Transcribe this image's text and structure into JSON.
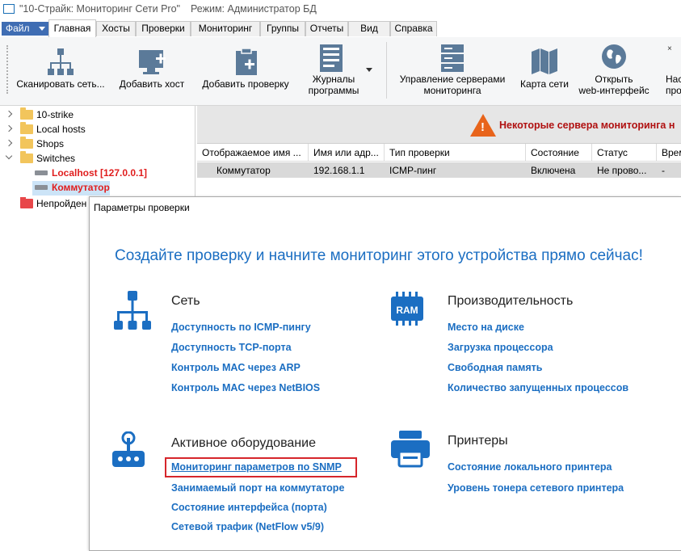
{
  "window": {
    "title": "\"10-Страйк: Мониторинг Сети Pro\"",
    "mode": "Режим: Администратор БД"
  },
  "menu": {
    "file": "Файл",
    "tabs": [
      "Главная",
      "Хосты",
      "Проверки",
      "Мониторинг",
      "Группы",
      "Отчеты",
      "Вид",
      "Справка"
    ]
  },
  "ribbon": {
    "buttons": [
      {
        "label": "Сканировать сеть...",
        "icon": "network-scan-icon"
      },
      {
        "label": "Добавить хост",
        "icon": "add-host-icon"
      },
      {
        "label": "Добавить проверку",
        "icon": "add-check-icon"
      },
      {
        "label": "Журналы\nпрограммы",
        "icon": "logs-icon"
      },
      {
        "label": "Управление серверами\nмониторинга",
        "icon": "servers-icon"
      },
      {
        "label": "Карта сети",
        "icon": "network-map-icon"
      },
      {
        "label": "Открыть\nweb-интерфейс",
        "icon": "globe-icon"
      },
      {
        "label": "Нас\nпро",
        "icon": "settings-icon"
      }
    ]
  },
  "tree": {
    "items": [
      {
        "label": "10-strike",
        "type": "folder"
      },
      {
        "label": "Local hosts",
        "type": "folder"
      },
      {
        "label": "Shops",
        "type": "folder"
      },
      {
        "label": "Switches",
        "type": "folder"
      },
      {
        "label": "Localhost [127.0.0.1]",
        "type": "host"
      },
      {
        "label": "Коммутатор",
        "type": "host"
      },
      {
        "label": "Непройден",
        "type": "folder"
      }
    ]
  },
  "alert": {
    "text": "Некоторые сервера мониторинга н"
  },
  "grid": {
    "headers": [
      "Отображаемое имя ...",
      "Имя или адр...",
      "Тип проверки",
      "Состояние",
      "Статус",
      "Врем"
    ],
    "rows": [
      [
        "Коммутатор",
        "192.168.1.1",
        "ICMP-пинг",
        "Включена",
        "Не прово...",
        "-"
      ]
    ]
  },
  "dialog": {
    "title": "Параметры проверки",
    "heading": "Создайте проверку и начните мониторинг этого устройства прямо сейчас!",
    "sections": [
      {
        "title": "Сеть",
        "icon": "network-icon",
        "links": [
          "Доступность по ICMP-пингу",
          "Доступность TCP-порта",
          "Контроль MAC через ARP",
          "Контроль MAC через NetBIOS"
        ]
      },
      {
        "title": "Производительность",
        "icon": "ram-icon",
        "links": [
          "Место на диске",
          "Загрузка процессора",
          "Свободная память",
          "Количество запущенных процессов"
        ]
      },
      {
        "title": "Активное оборудование",
        "icon": "router-icon",
        "links": [
          "Мониторинг параметров по SNMP",
          "Занимаемый порт на коммутаторе",
          "Состояние интерфейса (порта)",
          "Сетевой трафик (NetFlow v5/9)"
        ]
      },
      {
        "title": "Принтеры",
        "icon": "printer-icon",
        "links": [
          "Состояние локального принтера",
          "Уровень тонера сетевого принтера"
        ]
      }
    ]
  },
  "colors": {
    "accent": "#1b6ec2",
    "ribbon_icon": "#5b7a99",
    "highlight": "#d6262b",
    "file_button": "#3f6db3"
  }
}
